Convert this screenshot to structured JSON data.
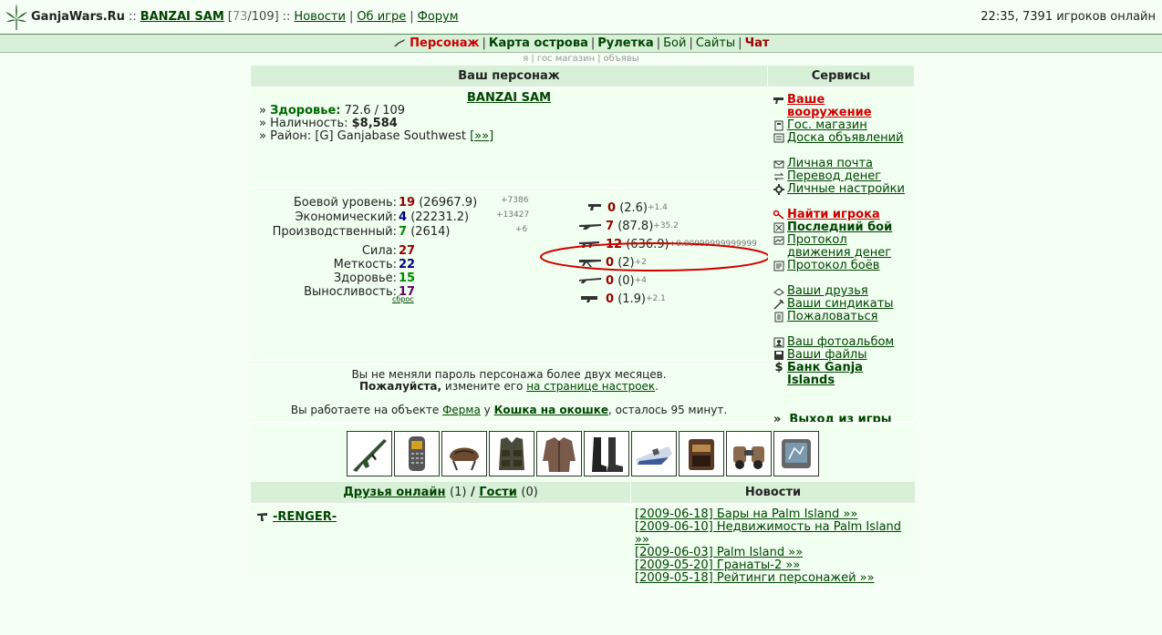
{
  "topbar": {
    "site": "GanjaWars.Ru",
    "sep": "::",
    "player": "BANZAI SAM",
    "hp_open": "[",
    "hp_current": "73",
    "hp_rest": "/109]",
    "sep2": "::",
    "links": [
      "Новости",
      "Об игре",
      "Форум"
    ],
    "status": "22:35, 7391 игроков онлайн"
  },
  "nav": {
    "items": [
      "Персонаж",
      "Карта острова",
      "Рулетка",
      "Бой",
      "Сайты",
      "Чат"
    ],
    "sub": [
      "я",
      "гос магазин",
      "объявы"
    ]
  },
  "char": {
    "header": "Ваш персонаж",
    "name": "BANZAI SAM",
    "health_label": "Здоровье:",
    "health": "72.6 / 109",
    "cash_label": "Наличность:",
    "cash": "$8,584",
    "district_label": "Район:",
    "district": "[G] Ganjabase Southwest",
    "district_link": "[»»]",
    "levels": [
      {
        "label": "Боевой уровень:",
        "value": "19",
        "exp": "(26967.9)",
        "delta": "+7386"
      },
      {
        "label": "Экономический:",
        "value": "4",
        "exp": "(22231.2)",
        "delta": "+13427"
      },
      {
        "label": "Производственный:",
        "value": "7",
        "exp": "(2614)",
        "delta": "+6"
      }
    ],
    "attrs": [
      {
        "label": "Сила:",
        "value": "27"
      },
      {
        "label": "Меткость:",
        "value": "22"
      },
      {
        "label": "Здоровье:",
        "value": "15"
      },
      {
        "label": "Выносливость:",
        "value": "17"
      }
    ],
    "reset": "сброс",
    "skills": [
      {
        "icon": "pistol-icon",
        "value": "0",
        "exp": "(2.6)",
        "delta": "+1.4"
      },
      {
        "icon": "shotgun-icon",
        "value": "7",
        "exp": "(87.8)",
        "delta": "+35.2"
      },
      {
        "icon": "assault-rifle-icon",
        "value": "12",
        "exp": "(636.9)",
        "delta": "+0.00999999999999"
      },
      {
        "icon": "machine-gun-icon",
        "value": "0",
        "exp": "(2)",
        "delta": "+2"
      },
      {
        "icon": "sniper-rifle-icon",
        "value": "0",
        "exp": "(0)",
        "delta": "+4"
      },
      {
        "icon": "grenade-launcher-icon",
        "value": "0",
        "exp": "(1.9)",
        "delta": "+2.1"
      }
    ],
    "notice1": "Вы не меняли пароль персонажа более двух месяцев.",
    "notice2_bold": "Пожалуйста,",
    "notice2_text": "измените его",
    "notice2_link": "на странице настроек",
    "notice2_end": ".",
    "work_text1": "Вы работаете на объекте",
    "work_link1": "Ферма",
    "work_text2": "у",
    "work_link2": "Кошка на окошке",
    "work_text3": ", осталось 95 минут."
  },
  "services": {
    "header": "Сервисы",
    "items": [
      "Ваше вооружение",
      "Гос. магазин",
      "Доска объявлений",
      "Личная почта",
      "Перевод денег",
      "Личные настройки",
      "Найти игрока",
      "Последний бой",
      "Протокол движения денег",
      "Протокол боёв",
      "Ваши друзья",
      "Ваши синдикаты",
      "Пожаловаться",
      "Ваш фотоальбом",
      "Ваши файлы",
      "Банк Ganja Islands"
    ],
    "logout_prefix": "»",
    "logout": "Выход из игры"
  },
  "friends": {
    "header_link1": "Друзья онлайн",
    "header_count1": "(1)",
    "header_slash": "/",
    "header_link2": "Гости",
    "header_count2": "(0)",
    "list": [
      "-RENGER-"
    ]
  },
  "news": {
    "header": "Новости",
    "items": [
      "[2009-06-18] Бары на Palm Island »»",
      "[2009-06-10] Недвижимость на Palm Island »»",
      "[2009-06-03] Palm Island »»",
      "[2009-05-20] Гранаты-2 »»",
      "[2009-05-18] Рейтинги персонажей »»"
    ]
  },
  "equipment": [
    "rifle",
    "phone",
    "helmet",
    "vest",
    "jacket",
    "boots",
    "boat",
    "radio",
    "binoculars",
    "gps"
  ],
  "colors": {
    "accent_red": "#cc0000",
    "dark_green": "#004400",
    "header_bg": "#d8f0d8",
    "panel_bg": "#f0fff0"
  }
}
